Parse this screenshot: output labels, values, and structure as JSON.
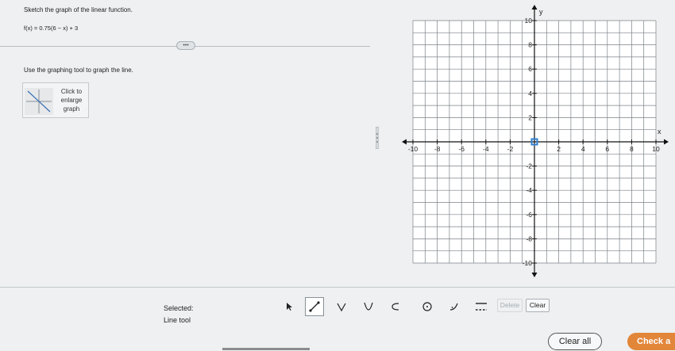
{
  "question": {
    "prompt": "Sketch the graph of the linear function.",
    "function": "f(x) = 0.75(6 − x) + 3",
    "more_indicator": "•••",
    "instruction": "Use the graphing tool to graph the line."
  },
  "enlarge_button": {
    "line1": "Click to",
    "line2": "enlarge",
    "line3": "graph"
  },
  "graph": {
    "x_label": "x",
    "y_label": "y",
    "x_range": [
      -10,
      10
    ],
    "y_range": [
      -10,
      10
    ],
    "grid_step": 1,
    "x_tick_labels": [
      "-10",
      "-8",
      "-6",
      "-4",
      "-2",
      "2",
      "4",
      "6",
      "8",
      "10"
    ],
    "y_tick_labels": [
      "10",
      "8",
      "6",
      "4",
      "2",
      "-2",
      "-4",
      "-6",
      "-8",
      "-10"
    ],
    "highlighted_point": [
      0,
      0
    ],
    "highlight_color": "#2f7fd0",
    "grid_color": "#7b8187"
  },
  "toolbar": {
    "selected_label": "Selected:",
    "selected_tool": "Line tool",
    "tools": [
      "pointer-icon",
      "line-icon",
      "absolute-value-icon",
      "parabola-icon",
      "arc-icon",
      "circle-icon",
      "exponential-icon",
      "dashed-solid-icon"
    ],
    "delete_label": "Delete",
    "clear_label": "Clear"
  },
  "actions": {
    "clear_all_label": "Clear all",
    "check_answer_label": "Check a"
  },
  "colors": {
    "accent": "#e2863a",
    "background": "#eef0f1"
  }
}
